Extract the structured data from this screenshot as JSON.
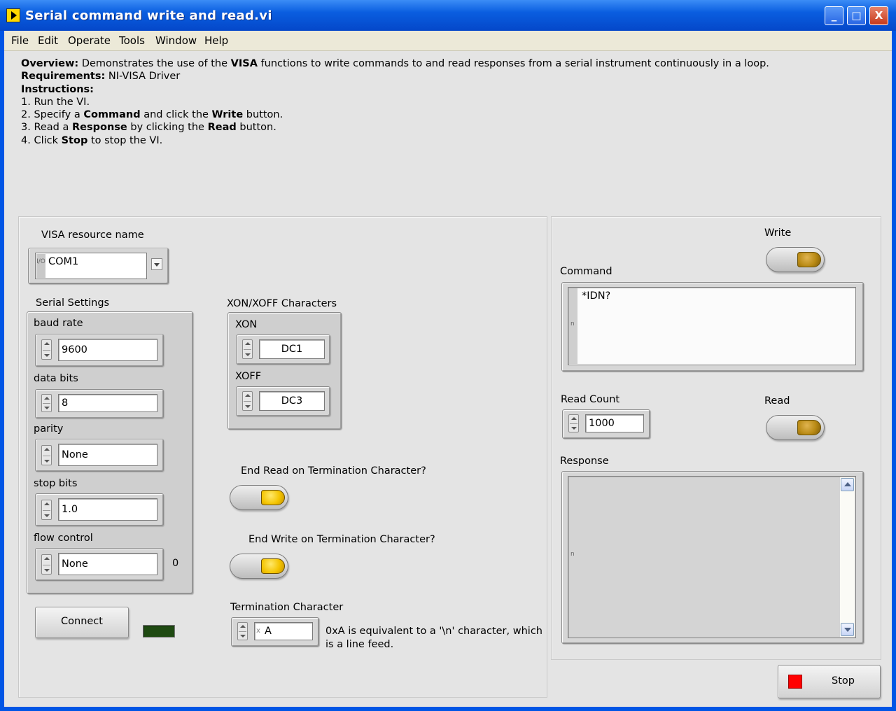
{
  "window": {
    "title": "Serial command write and read.vi",
    "controls": {
      "minimize": "_",
      "maximize": "□",
      "close": "X"
    }
  },
  "menu": [
    "File",
    "Edit",
    "Operate",
    "Tools",
    "Window",
    "Help"
  ],
  "description": {
    "overview_label": "Overview:",
    "overview_pre": "Demonstrates the use of the",
    "overview_bold": "VISA",
    "overview_post": "functions to write commands to and read responses from a serial instrument continuously in a loop.",
    "requirements_label": "Requirements:",
    "requirements_text": "NI-VISA Driver",
    "instructions_label": "Instructions:",
    "step1": "1. Run the VI.",
    "step2_a": "2. Specify a",
    "step2_b": "Command",
    "step2_c": "and click the",
    "step2_d": "Write",
    "step2_e": "button.",
    "step3_a": "3. Read a",
    "step3_b": "Response",
    "step3_c": "by clicking the",
    "step3_d": "Read",
    "step3_e": "button.",
    "step4_a": "4. Click",
    "step4_b": "Stop",
    "step4_c": "to stop the VI."
  },
  "visa": {
    "label": "VISA resource name",
    "prefix_icon": "I/O",
    "value": "COM1"
  },
  "serial_settings": {
    "label": "Serial Settings",
    "baud_rate_label": "baud rate",
    "baud_rate_value": "9600",
    "data_bits_label": "data bits",
    "data_bits_value": "8",
    "parity_label": "parity",
    "parity_value": "None",
    "stop_bits_label": "stop bits",
    "stop_bits_value": "1.0",
    "flow_control_label": "flow control",
    "flow_control_value": "None",
    "flow_control_index": "0"
  },
  "xon_xoff": {
    "label": "XON/XOFF Characters",
    "xon_label": "XON",
    "xon_value": "DC1",
    "xoff_label": "XOFF",
    "xoff_value": "DC3"
  },
  "end_read": {
    "label": "End Read on Termination Character?"
  },
  "end_write": {
    "label": "End Write on Termination Character?"
  },
  "termination": {
    "label": "Termination Character",
    "radix": "x",
    "value": "A",
    "note_line1": "0xA is equivalent to a '\\n' character, which",
    "note_line2": "is a line feed."
  },
  "connect": {
    "label": "Connect"
  },
  "write": {
    "label": "Write"
  },
  "command": {
    "label": "Command",
    "value": "*IDN?",
    "indicator": "n"
  },
  "read_count": {
    "label": "Read Count",
    "value": "1000"
  },
  "read": {
    "label": "Read"
  },
  "response": {
    "label": "Response",
    "value": "",
    "indicator": "n"
  },
  "stop": {
    "label": "Stop"
  },
  "colors": {
    "titlebar": "#0a5ee0",
    "panel": "#e4e4e4",
    "led_on": "#f4c400",
    "stop_square": "#ff0000",
    "connect_led_off": "#1f4a12"
  }
}
